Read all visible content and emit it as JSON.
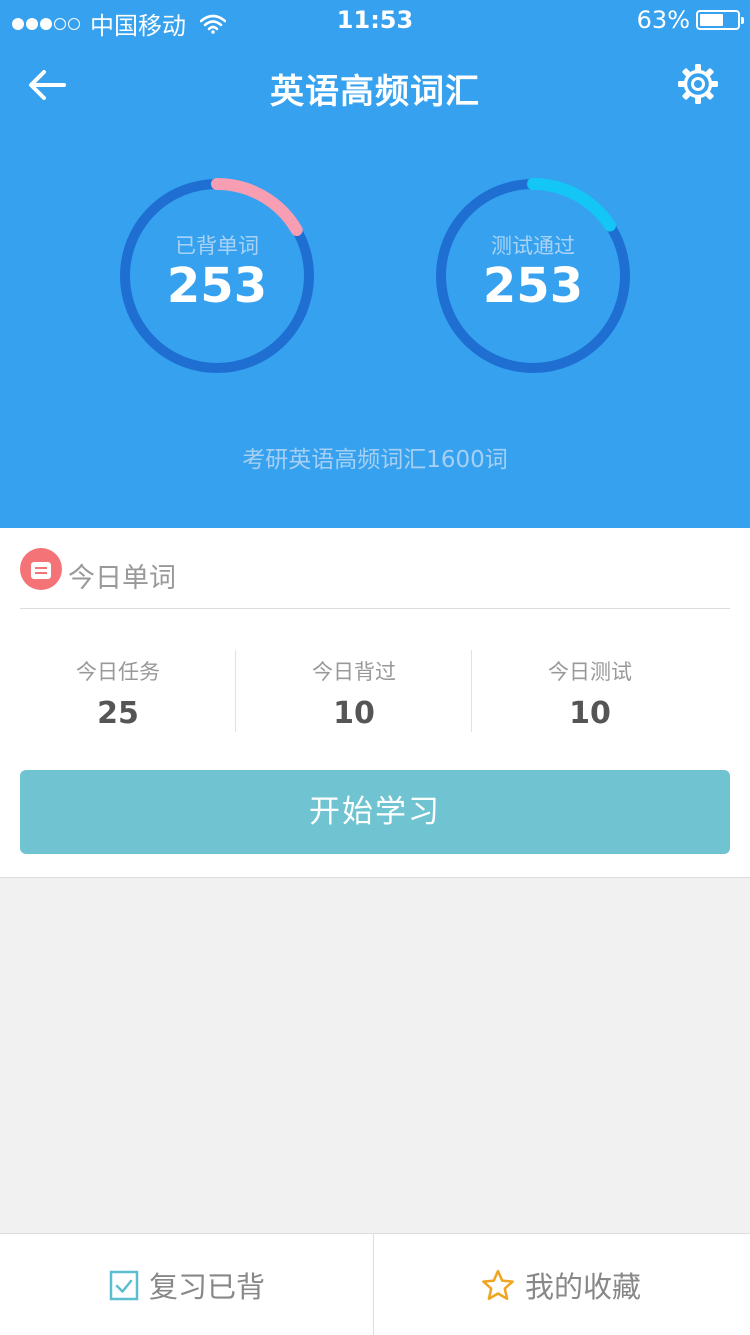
{
  "status_bar": {
    "carrier": "中国移动",
    "time": "11:53",
    "battery": "63%",
    "battery_level": 0.63
  },
  "nav": {
    "title": "英语高频词汇"
  },
  "progress": {
    "memorized": {
      "label": "已背单词",
      "value": "253"
    },
    "tested": {
      "label": "测试通过",
      "value": "253"
    }
  },
  "subtitle": "考研英语高频词汇1600词",
  "today": {
    "title": "今日单词",
    "stats": [
      {
        "label": "今日任务",
        "value": "25"
      },
      {
        "label": "今日背过",
        "value": "10"
      },
      {
        "label": "今日测试",
        "value": "10"
      }
    ],
    "start_button": "开始学习"
  },
  "bottom_bar": {
    "review_label": "复习已背",
    "favorites_label": "我的收藏"
  },
  "colors": {
    "header_bg": "#36a1ee",
    "ring_track": "#1f6fd2",
    "ring_memorized": "#f79eb3",
    "ring_tested": "#13c6f5",
    "start_button": "#70c3d1",
    "today_icon": "#f37377",
    "star": "#f0a521",
    "checkbox": "#5bbfcf"
  },
  "icons": {
    "back": "arrow-left-icon",
    "settings": "gear-icon",
    "today": "document-icon",
    "review": "checkbox-icon",
    "favorites": "star-icon"
  }
}
